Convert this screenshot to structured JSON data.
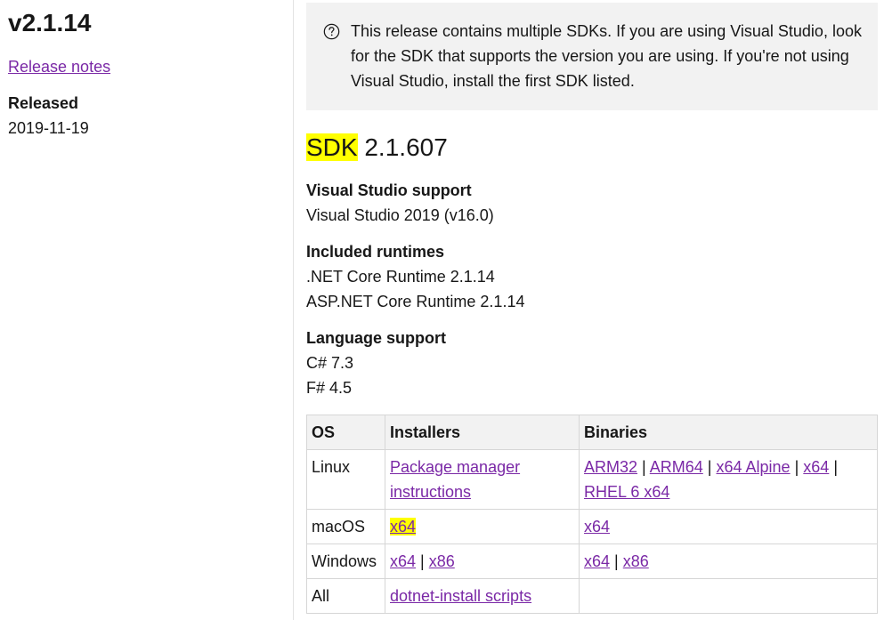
{
  "sidebar": {
    "version": "v2.1.14",
    "release_notes_label": "Release notes",
    "released_label": "Released",
    "released_date": "2019-11-19"
  },
  "note": {
    "icon": "question-circle-icon",
    "text": "This release contains multiple SDKs. If you are using Visual Studio, look for the SDK that supports the version you are using. If you're not using Visual Studio, install the first SDK listed."
  },
  "sdk": {
    "heading_prefix": "SDK",
    "heading_version": "2.1.607",
    "vs_support_label": "Visual Studio support",
    "vs_support_value": "Visual Studio 2019 (v16.0)",
    "runtimes_label": "Included runtimes",
    "runtimes": [
      ".NET Core Runtime 2.1.14",
      "ASP.NET Core Runtime 2.1.14"
    ],
    "language_label": "Language support",
    "languages": [
      "C# 7.3",
      "F# 4.5"
    ]
  },
  "table": {
    "headers": [
      "OS",
      "Installers",
      "Binaries"
    ],
    "rows": [
      {
        "os": "Linux",
        "installers": [
          "Package manager instructions"
        ],
        "binaries": [
          "ARM32",
          "ARM64",
          "x64 Alpine",
          "x64",
          "RHEL 6 x64"
        ]
      },
      {
        "os": "macOS",
        "installers": [
          "x64"
        ],
        "binaries": [
          "x64"
        ]
      },
      {
        "os": "Windows",
        "installers": [
          "x64",
          "x86"
        ],
        "binaries": [
          "x64",
          "x86"
        ]
      },
      {
        "os": "All",
        "installers": [
          "dotnet-install scripts"
        ],
        "binaries": []
      }
    ],
    "separator": "|"
  },
  "colors": {
    "link": "#7a28a6",
    "highlight": "#ffff00",
    "note_background": "#f2f2f2",
    "table_header_background": "#f2f2f2",
    "border": "#d6d6d6"
  }
}
